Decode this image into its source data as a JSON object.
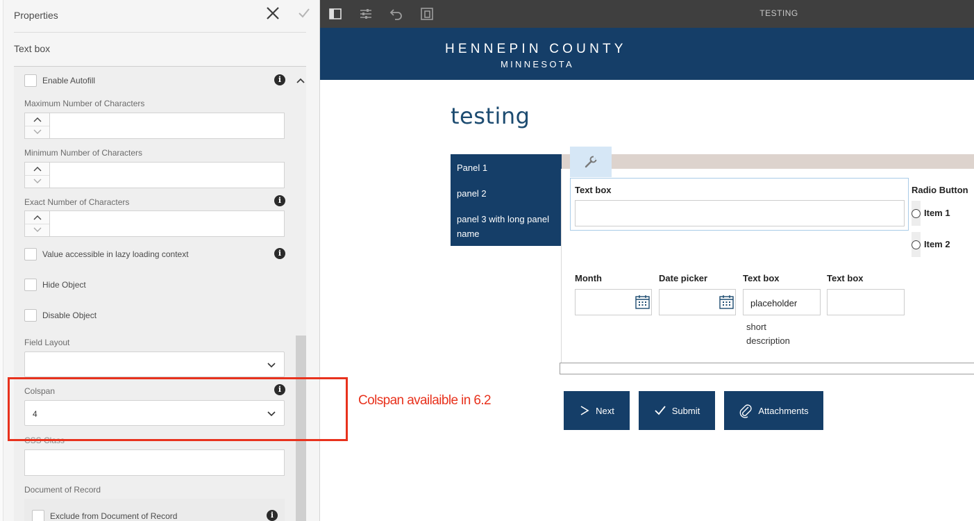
{
  "properties_panel": {
    "title": "Properties",
    "subtitle": "Text box",
    "fields": {
      "enable_autofill": "Enable Autofill",
      "max_chars_label": "Maximum Number of Characters",
      "min_chars_label": "Minimum Number of Characters",
      "exact_chars_label": "Exact Number of Characters",
      "lazy_loading": "Value accessible in lazy loading context",
      "hide_object": "Hide Object",
      "disable_object": "Disable Object",
      "field_layout_label": "Field Layout",
      "field_layout_value": "",
      "colspan_label": "Colspan",
      "colspan_value": "4",
      "css_class_label": "CSS Class",
      "document_of_record_label": "Document of Record",
      "exclude_from_dor": "Exclude from Document of Record"
    }
  },
  "toolbar": {
    "title": "TESTING",
    "icons": [
      "sidebar-toggle-icon",
      "sliders-icon",
      "undo-icon",
      "preview-icon"
    ]
  },
  "banner": {
    "title": "HENNEPIN COUNTY",
    "subtitle": "MINNESOTA",
    "color": "#153e68"
  },
  "form": {
    "title": "testing",
    "nav_items": [
      "Panel 1",
      "panel 2",
      "panel 3 with long panel name"
    ],
    "textbox_label": "Text box",
    "radio_group_label": "Radio Button",
    "radio_items": [
      "Item 1",
      "Item 2"
    ],
    "month_label": "Month",
    "datepicker_label": "Date picker",
    "textbox2_label": "Text box",
    "textbox2_placeholder": "placeholder",
    "textbox2_description": "short description",
    "textbox3_label": "Text box",
    "buttons": {
      "next": "Next",
      "submit": "Submit",
      "attachments": "Attachments"
    }
  },
  "annotation": {
    "text": "Colspan availaible in 6.2",
    "color": "#e8321d"
  }
}
